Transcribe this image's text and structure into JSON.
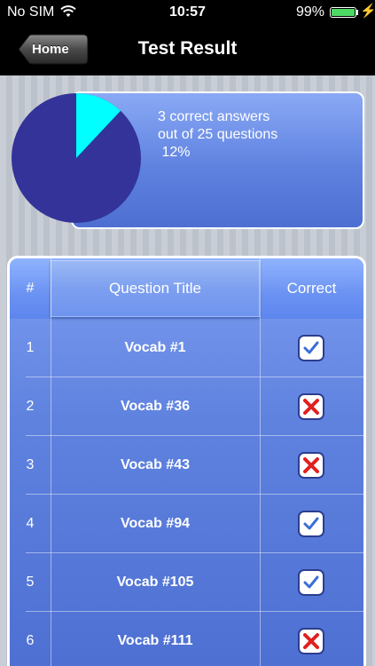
{
  "status_bar": {
    "carrier": "No SIM",
    "time": "10:57",
    "battery": "99%",
    "icons": [
      "wifi-icon",
      "battery-icon",
      "charging-bolt-icon"
    ]
  },
  "nav": {
    "back_label": "Home",
    "title": "Test Result"
  },
  "result": {
    "line1": "3 correct answers",
    "line2": "out of 25 questions",
    "line3": " 12%",
    "correct": 3,
    "total": 25,
    "colors": {
      "correct": "#00ffff",
      "incorrect": "#333399"
    }
  },
  "table": {
    "columns": [
      "#",
      "Question Title",
      "Correct"
    ],
    "rows": [
      {
        "num": "1",
        "title": "Vocab #1",
        "correct": true
      },
      {
        "num": "2",
        "title": "Vocab #36",
        "correct": false
      },
      {
        "num": "3",
        "title": "Vocab #43",
        "correct": false
      },
      {
        "num": "4",
        "title": "Vocab #94",
        "correct": true
      },
      {
        "num": "5",
        "title": "Vocab #105",
        "correct": true
      },
      {
        "num": "6",
        "title": "Vocab #111",
        "correct": false
      }
    ],
    "icons": {
      "correct": "checkbox-checked-icon",
      "incorrect": "cross-icon"
    }
  }
}
